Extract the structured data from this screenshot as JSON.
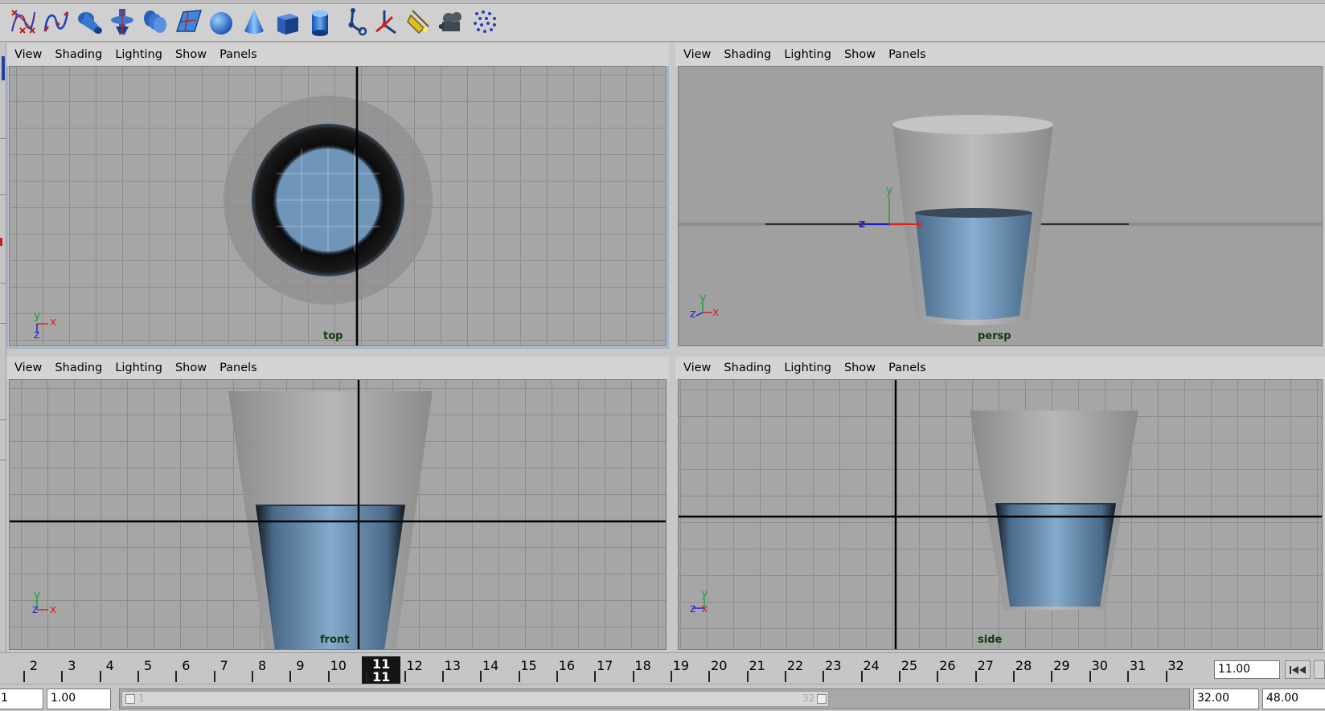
{
  "shelf": {
    "icons": [
      "cv-curve-tool-icon",
      "ep-curve-tool-icon",
      "revolve-icon",
      "loft-icon",
      "extrude-icon",
      "planar-surface-icon",
      "nurbs-sphere-icon",
      "nurbs-cone-icon",
      "nurbs-cube-icon",
      "nurbs-cylinder-icon",
      "joint-tool-icon",
      "ik-handle-icon",
      "spot-light-icon",
      "camera-icon",
      "particle-tool-icon"
    ]
  },
  "menu": {
    "view": "View",
    "shading": "Shading",
    "lighting": "Lighting",
    "show": "Show",
    "panels": "Panels"
  },
  "panes": {
    "top": {
      "label": "top"
    },
    "persp": {
      "label": "persp"
    },
    "front": {
      "label": "front"
    },
    "side": {
      "label": "side"
    }
  },
  "axes": {
    "x": "x",
    "y": "y",
    "z": "z"
  },
  "timeline": {
    "frames": [
      "2",
      "3",
      "4",
      "5",
      "6",
      "7",
      "8",
      "9",
      "10",
      "11",
      "12",
      "13",
      "14",
      "15",
      "16",
      "17",
      "18",
      "19",
      "20",
      "21",
      "22",
      "23",
      "24",
      "25",
      "26",
      "27",
      "28",
      "29",
      "30",
      "31",
      "32"
    ],
    "current_frame": "11",
    "current_time": "11.00"
  },
  "range": {
    "start_left": "1",
    "start_time": "1.00",
    "slider_start": "1",
    "slider_end": "32",
    "end_time": "32.00",
    "end_range": "48.00"
  },
  "colors": {
    "viewport_bg": "#a6a6a6",
    "grid": "#8c8c8c",
    "active_border": "#9ab4d8",
    "water": "#6f95b8",
    "glass": "#b4b4b4",
    "axis_x": "#e02020",
    "axis_y": "#20a040",
    "axis_z": "#2020d0"
  }
}
